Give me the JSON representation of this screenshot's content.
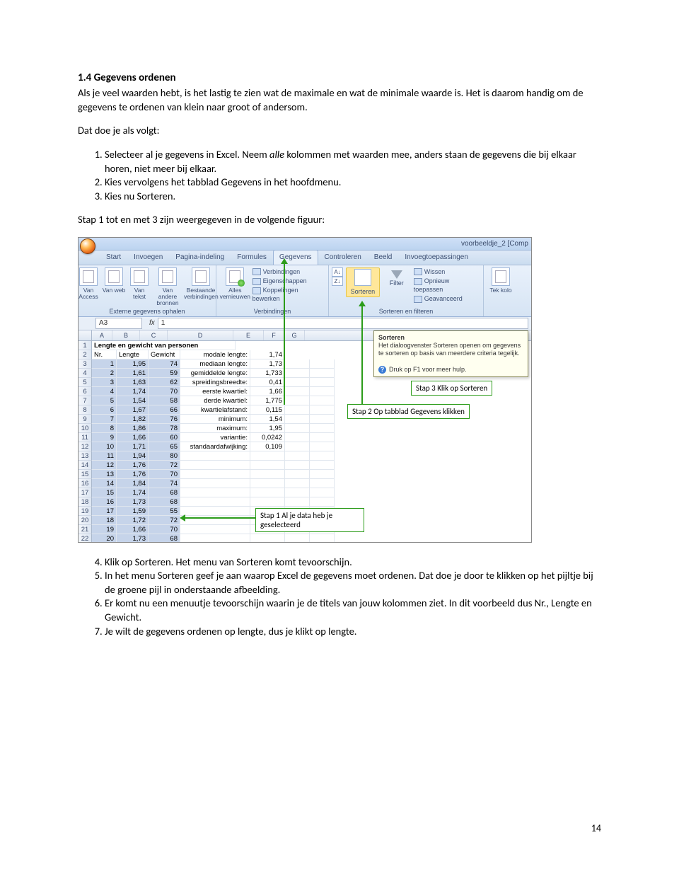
{
  "heading": "1.4 Gegevens ordenen",
  "intro": "Als je veel waarden hebt, is het lastig te zien wat de maximale en wat de minimale waarde is. Het is daarom handig om de gegevens te ordenen van klein naar groot of andersom.",
  "lead_in": "Dat doe je als volgt:",
  "steps_a": {
    "s1_a": "Selecteer al je gegevens in Excel. Neem ",
    "s1_i": "alle",
    "s1_b": " kolommen met waarden mee, anders staan de gegevens die bij elkaar horen, niet meer bij elkaar.",
    "s2": "Kies vervolgens het tabblad Gegevens in het hoofdmenu.",
    "s3": "Kies nu Sorteren."
  },
  "figure_caption": "Stap 1 tot en met 3 zijn weergegeven in de volgende figuur:",
  "excel": {
    "title": "voorbeeldje_2  [Comp",
    "tabs": [
      "Start",
      "Invoegen",
      "Pagina-indeling",
      "Formules",
      "Gegevens",
      "Controleren",
      "Beeld",
      "Invoegtoepassingen"
    ],
    "grp1": {
      "b1": "Van Access",
      "b2": "Van web",
      "b3": "Van tekst",
      "b4": "Van andere bronnen",
      "b5": "Bestaande verbindingen",
      "label": "Externe gegevens ophalen"
    },
    "grp2": {
      "b1": "Alles vernieuwen",
      "r1": "Verbindingen",
      "r2": "Eigenschappen",
      "r3": "Koppelingen bewerken",
      "label": "Verbindingen"
    },
    "grp3": {
      "sort": "Sorteren",
      "filter": "Filter",
      "r1": "Wissen",
      "r2": "Opnieuw toepassen",
      "r3": "Geavanceerd",
      "label": "Sorteren en filteren"
    },
    "grp4": {
      "b1": "Tek kolo"
    },
    "namebox": "A3",
    "fx": "1",
    "cols": [
      "A",
      "B",
      "C",
      "D",
      "E",
      "F",
      "G"
    ],
    "row1_title": "Lengte en gewicht van personen",
    "row2": {
      "a": "Nr.",
      "b": "Lengte",
      "c": "Gewicht",
      "d": "modale lengte:",
      "e": "1,74"
    },
    "statlabels": [
      "mediaan lengte:",
      "gemiddelde lengte:",
      "spreidingsbreedte:",
      "eerste kwartiel:",
      "derde kwartiel:",
      "kwartielafstand:",
      "minimum:",
      "maximum:",
      "variantie:",
      "standaardafwijking:"
    ],
    "statvals": [
      "1,73",
      "1,733",
      "0,41",
      "1,66",
      "1,775",
      "0,115",
      "1,54",
      "1,95",
      "0,0242",
      "0,109"
    ],
    "data_rows": [
      {
        "r": 3,
        "a": "1",
        "b": "1,95",
        "c": "74"
      },
      {
        "r": 4,
        "a": "2",
        "b": "1,61",
        "c": "59"
      },
      {
        "r": 5,
        "a": "3",
        "b": "1,63",
        "c": "62"
      },
      {
        "r": 6,
        "a": "4",
        "b": "1,74",
        "c": "70"
      },
      {
        "r": 7,
        "a": "5",
        "b": "1,54",
        "c": "58"
      },
      {
        "r": 8,
        "a": "6",
        "b": "1,67",
        "c": "66"
      },
      {
        "r": 9,
        "a": "7",
        "b": "1,82",
        "c": "76"
      },
      {
        "r": 10,
        "a": "8",
        "b": "1,86",
        "c": "78"
      },
      {
        "r": 11,
        "a": "9",
        "b": "1,66",
        "c": "60"
      },
      {
        "r": 12,
        "a": "10",
        "b": "1,71",
        "c": "65"
      },
      {
        "r": 13,
        "a": "11",
        "b": "1,94",
        "c": "80"
      },
      {
        "r": 14,
        "a": "12",
        "b": "1,76",
        "c": "72"
      },
      {
        "r": 15,
        "a": "13",
        "b": "1,76",
        "c": "70"
      },
      {
        "r": 16,
        "a": "14",
        "b": "1,84",
        "c": "74"
      },
      {
        "r": 17,
        "a": "15",
        "b": "1,74",
        "c": "68"
      },
      {
        "r": 18,
        "a": "16",
        "b": "1,73",
        "c": "68"
      },
      {
        "r": 19,
        "a": "17",
        "b": "1,59",
        "c": "55"
      },
      {
        "r": 20,
        "a": "18",
        "b": "1,72",
        "c": "72"
      },
      {
        "r": 21,
        "a": "19",
        "b": "1,66",
        "c": "70"
      },
      {
        "r": 22,
        "a": "20",
        "b": "1,73",
        "c": "68"
      }
    ],
    "tooltip": {
      "title": "Sorteren",
      "body": "Het dialoogvenster Sorteren openen om gegevens te sorteren op basis van meerdere criteria tegelijk.",
      "help": "Druk op F1 voor meer hulp."
    },
    "callouts": {
      "c1": "Stap 1 Al je data heb je geselecteerd",
      "c2": "Stap 2 Op tabblad Gegevens klikken",
      "c3": "Stap 3 Klik op Sorteren"
    }
  },
  "steps_b": {
    "s4": "Klik op Sorteren. Het menu van Sorteren komt tevoorschijn.",
    "s5": "In het menu Sorteren geef je aan waarop Excel de gegevens moet ordenen. Dat doe je door te klikken op het pijltje bij de groene pijl in onderstaande afbeelding.",
    "s6": "Er komt nu een menuutje tevoorschijn waarin je de titels van jouw kolommen ziet. In dit voorbeeld dus Nr., Lengte en Gewicht.",
    "s7": "Je wilt de gegevens ordenen op lengte, dus je klikt op lengte."
  },
  "pagenum": "14"
}
